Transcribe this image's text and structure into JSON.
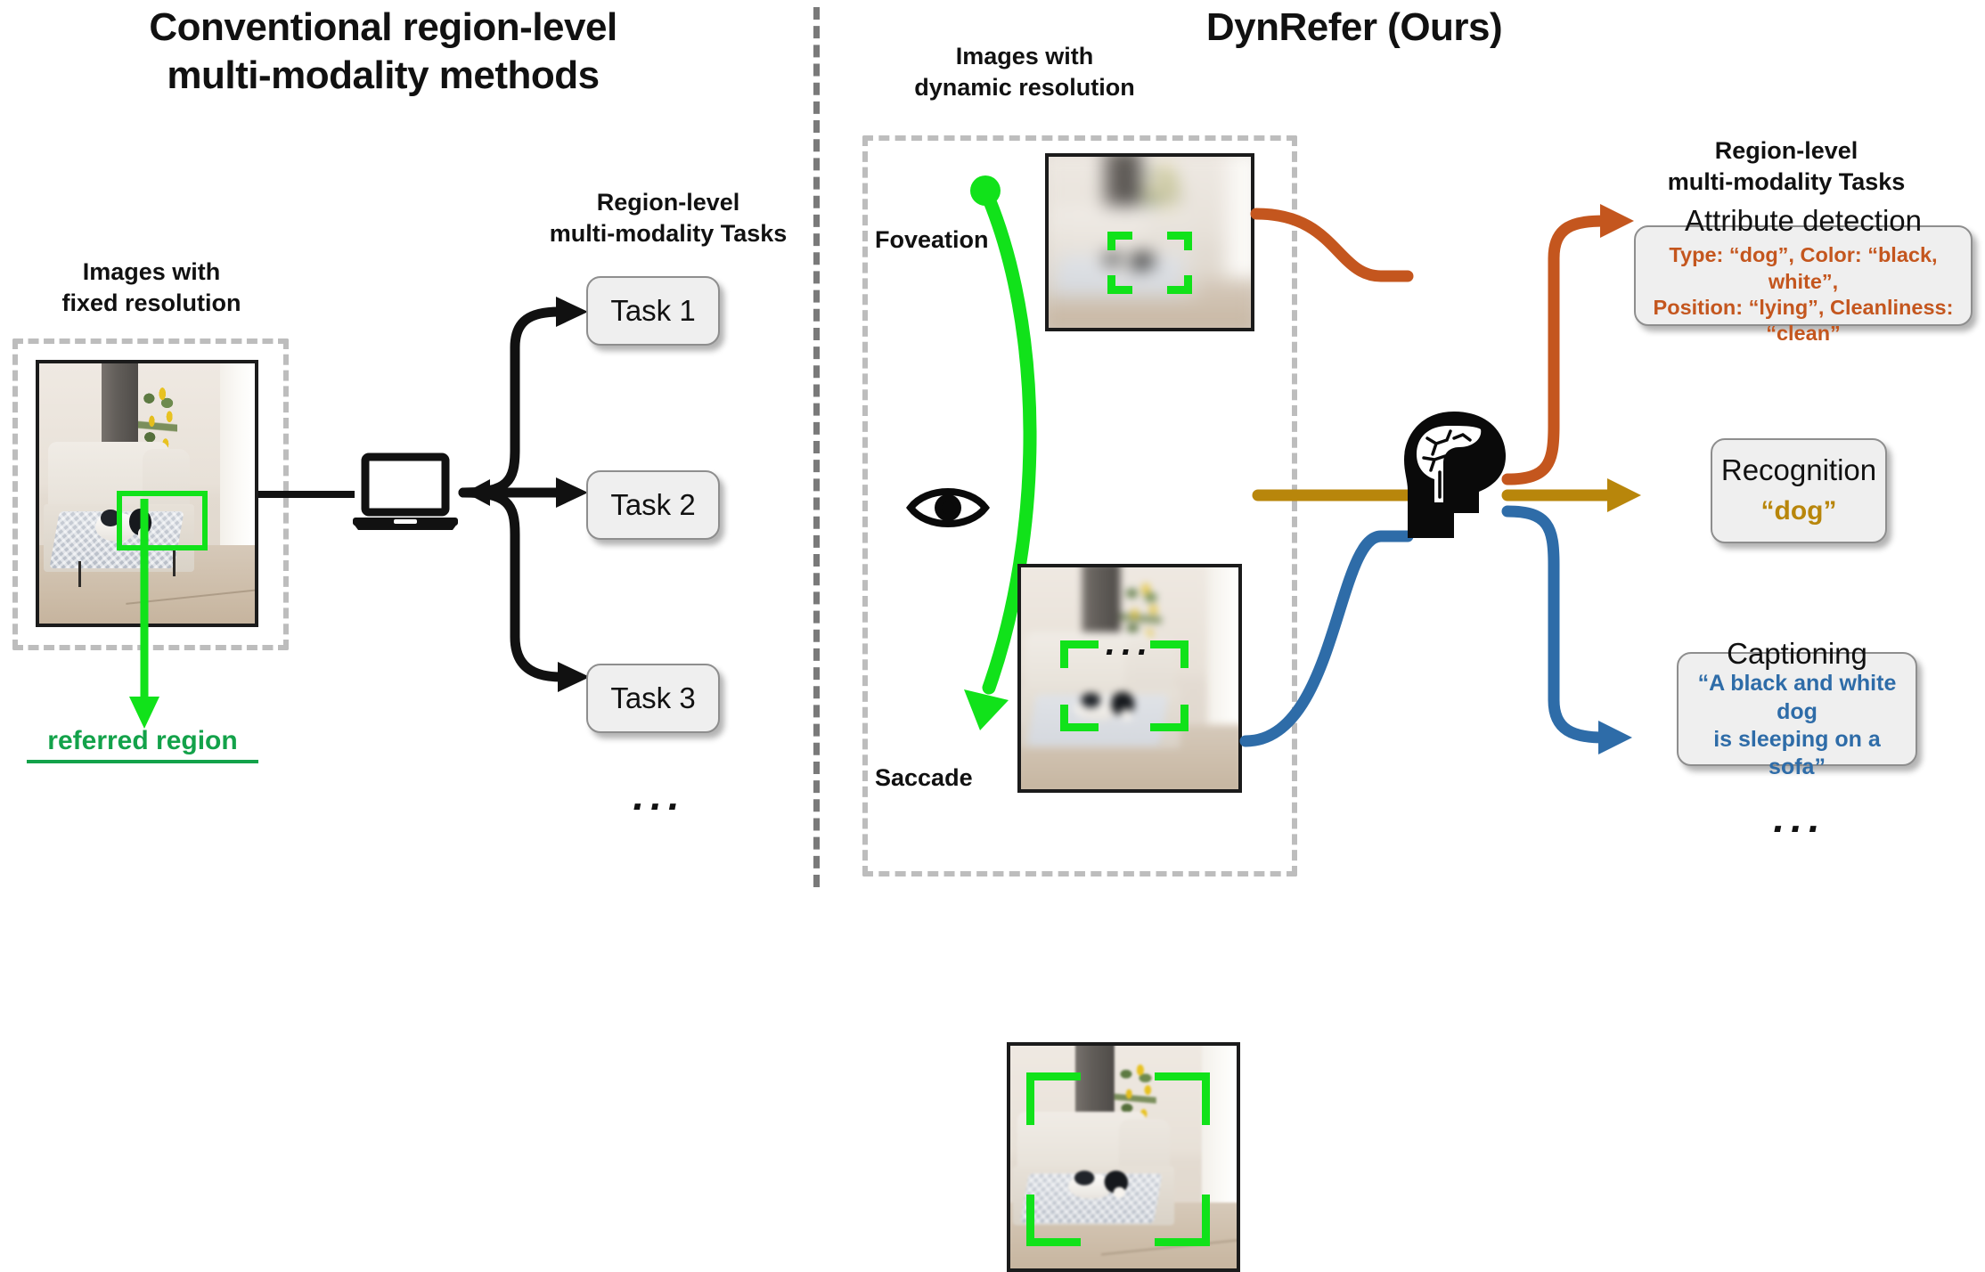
{
  "left_panel": {
    "title_line1": "Conventional region-level",
    "title_line2": "multi-modality methods",
    "image_caption_line1": "Images with",
    "image_caption_line2": "fixed resolution",
    "referred_region_label": "referred region",
    "referred_region_color": "#13a24a",
    "bbox_color": "#11e21a",
    "tasks_caption_line1": "Region-level",
    "tasks_caption_line2": "multi-modality Tasks",
    "tasks": [
      {
        "label": "Task 1"
      },
      {
        "label": "Task 2"
      },
      {
        "label": "Task 3"
      }
    ],
    "more_tasks_ellipsis": "...",
    "processor_icon": "laptop-icon"
  },
  "right_panel": {
    "title": "DynRefer (Ours)",
    "image_caption_line1": "Images with",
    "image_caption_line2": "dynamic resolution",
    "foveation_label": "Foveation",
    "saccade_label": "Saccade",
    "eye_icon": "eye-icon",
    "brain_icon": "brain-head-icon",
    "views_ellipsis": "...",
    "saccade_arrow_color": "#11e21a",
    "tasks_caption_line1": "Region-level",
    "tasks_caption_line2": "multi-modality Tasks",
    "results": [
      {
        "name": "attribute-detection",
        "title": "Attribute detection",
        "line1": "Type: “dog”, Color: “black, white”,",
        "line2": "Position: “lying”, Cleanliness: “clean”",
        "accent": "#C4561E"
      },
      {
        "name": "recognition",
        "title": "Recognition",
        "line1": "“dog”",
        "line2": "",
        "accent": "#B8860B"
      },
      {
        "name": "captioning",
        "title": "Captioning",
        "line1": "“A black and white dog",
        "line2": "is sleeping on a sofa”",
        "accent": "#2E6CA8"
      }
    ],
    "more_results_ellipsis": "..."
  }
}
